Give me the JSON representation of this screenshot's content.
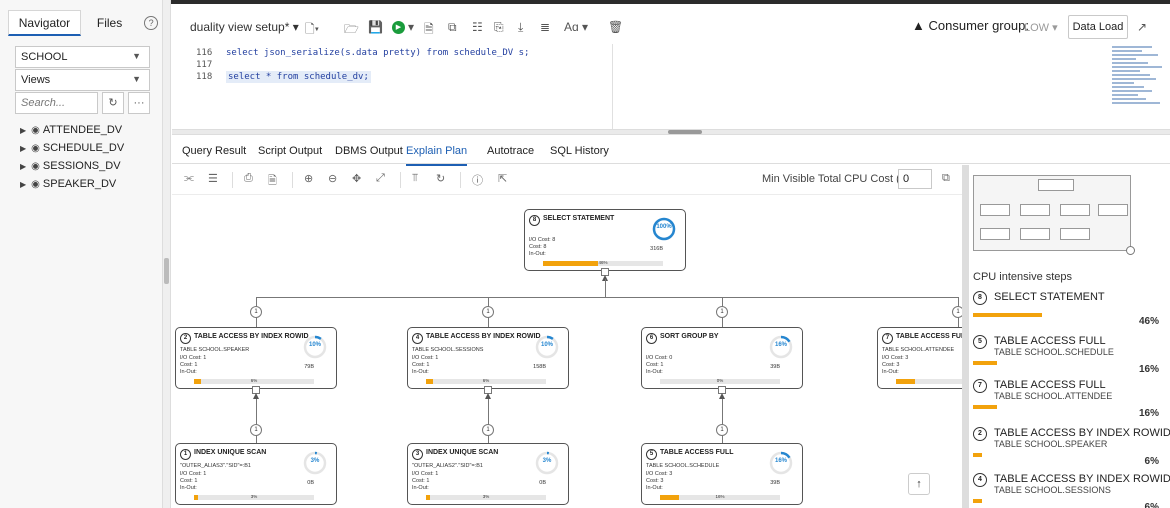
{
  "navigator": {
    "tab_navigator": "Navigator",
    "tab_files": "Files",
    "schema": "SCHOOL",
    "object_type": "Views",
    "search_placeholder": "Search...",
    "tree": [
      "ATTENDEE_DV",
      "SCHEDULE_DV",
      "SESSIONS_DV",
      "SPEAKER_DV"
    ]
  },
  "toolbar": {
    "worksheet": "duality view setup*",
    "consumer_label": "Consumer group:",
    "consumer_value": "LOW",
    "data_load": "Data Load"
  },
  "editor": {
    "lines": [
      {
        "n": "116",
        "code": "select json_serialize(s.data pretty) from schedule_DV s;"
      },
      {
        "n": "117",
        "code": ""
      },
      {
        "n": "118",
        "code": "select * from schedule_dv;"
      }
    ]
  },
  "result_tabs": [
    "Query Result",
    "Script Output",
    "DBMS Output",
    "Explain Plan",
    "Autotrace",
    "SQL History"
  ],
  "active_tab": "Explain Plan",
  "plan_toolbar": {
    "min_cpu_label": "Min Visible Total CPU Cost (%)",
    "min_cpu_value": "0"
  },
  "plan": {
    "root": {
      "id": "8",
      "op": "SELECT STATEMENT",
      "obj": "",
      "io": "I/O Cost: 8",
      "cost": "Cost: 8",
      "inout": "In-Out:",
      "bytes": "316B",
      "pct": "100%",
      "pct_val": 100,
      "bar": "46%",
      "bar_val": 46
    },
    "nodes": [
      {
        "id": "2",
        "op": "TABLE ACCESS BY INDEX ROWID",
        "obj": "TABLE SCHOOL.SPEAKER",
        "io": "I/O Cost: 1",
        "cost": "Cost: 1",
        "inout": "In-Out:",
        "bytes": "79B",
        "pct": "10%",
        "pct_val": 10,
        "bar": "6%",
        "bar_val": 6,
        "badge": "1"
      },
      {
        "id": "4",
        "op": "TABLE ACCESS BY INDEX ROWID",
        "obj": "TABLE SCHOOL.SESSIONS",
        "io": "I/O Cost: 1",
        "cost": "Cost: 1",
        "inout": "In-Out:",
        "bytes": "158B",
        "pct": "10%",
        "pct_val": 10,
        "bar": "6%",
        "bar_val": 6,
        "badge": "1"
      },
      {
        "id": "6",
        "op": "SORT GROUP BY",
        "obj": "",
        "io": "I/O Cost: 0",
        "cost": "Cost: 1",
        "inout": "In-Out:",
        "bytes": "39B",
        "pct": "16%",
        "pct_val": 16,
        "bar": "0%",
        "bar_val": 0,
        "badge": "1"
      },
      {
        "id": "7",
        "op": "TABLE ACCESS FULL",
        "obj": "TABLE SCHOOL.ATTENDEE",
        "io": "I/O Cost: 3",
        "cost": "Cost: 3",
        "inout": "In-Out:",
        "bytes": "",
        "pct": "",
        "pct_val": 16,
        "bar": "",
        "bar_val": 16,
        "badge": "1"
      }
    ],
    "children": [
      {
        "id": "1",
        "op": "INDEX UNIQUE SCAN",
        "obj": "\"OUTER_ALIAS3\".\"SID\"=:B1",
        "io": "I/O Cost: 1",
        "cost": "Cost: 1",
        "inout": "In-Out:",
        "bytes": "0B",
        "pct": "3%",
        "pct_val": 3,
        "bar": "3%",
        "bar_val": 3,
        "badge": "1"
      },
      {
        "id": "3",
        "op": "INDEX UNIQUE SCAN",
        "obj": "\"OUTER_ALIAS2\".\"SID\"=:B1",
        "io": "I/O Cost: 1",
        "cost": "Cost: 1",
        "inout": "In-Out:",
        "bytes": "0B",
        "pct": "3%",
        "pct_val": 3,
        "bar": "3%",
        "bar_val": 3,
        "badge": "1"
      },
      {
        "id": "5",
        "op": "TABLE ACCESS FULL",
        "obj": "TABLE SCHOOL.SCHEDULE",
        "io": "I/O Cost: 3",
        "cost": "Cost: 3",
        "inout": "In-Out:",
        "bytes": "39B",
        "pct": "16%",
        "pct_val": 16,
        "bar": "16%",
        "bar_val": 16,
        "badge": "1"
      }
    ]
  },
  "cpu_panel": {
    "title": "CPU intensive steps",
    "steps": [
      {
        "id": "8",
        "op": "SELECT STATEMENT",
        "obj": "",
        "pct": "46%",
        "val": 46
      },
      {
        "id": "5",
        "op": "TABLE ACCESS FULL",
        "obj": "TABLE SCHOOL.SCHEDULE",
        "pct": "16%",
        "val": 16
      },
      {
        "id": "7",
        "op": "TABLE ACCESS FULL",
        "obj": "TABLE SCHOOL.ATTENDEE",
        "pct": "16%",
        "val": 16
      },
      {
        "id": "2",
        "op": "TABLE ACCESS BY INDEX ROWID",
        "obj": "TABLE SCHOOL.SPEAKER",
        "pct": "6%",
        "val": 6
      },
      {
        "id": "4",
        "op": "TABLE ACCESS BY INDEX ROWID",
        "obj": "TABLE SCHOOL.SESSIONS",
        "pct": "6%",
        "val": 6
      }
    ]
  },
  "colors": {
    "accent": "#1d5fb3",
    "bar": "#f2a20c",
    "ring": "#2586d0",
    "run": "#1a9c3c"
  },
  "icons": [
    "help-icon",
    "eye-icon",
    "refresh-icon",
    "more-icon",
    "new-file-icon",
    "open-icon",
    "save-icon",
    "run-icon",
    "run-script-icon",
    "explain-icon",
    "autotrace-icon",
    "download-icon",
    "format-icon",
    "text-case-icon",
    "delete-icon",
    "warning-icon",
    "expand-icon",
    "zoom-in-icon",
    "zoom-out-icon",
    "move-icon",
    "fit-icon",
    "print-icon",
    "info-icon",
    "up-arrow-icon"
  ]
}
